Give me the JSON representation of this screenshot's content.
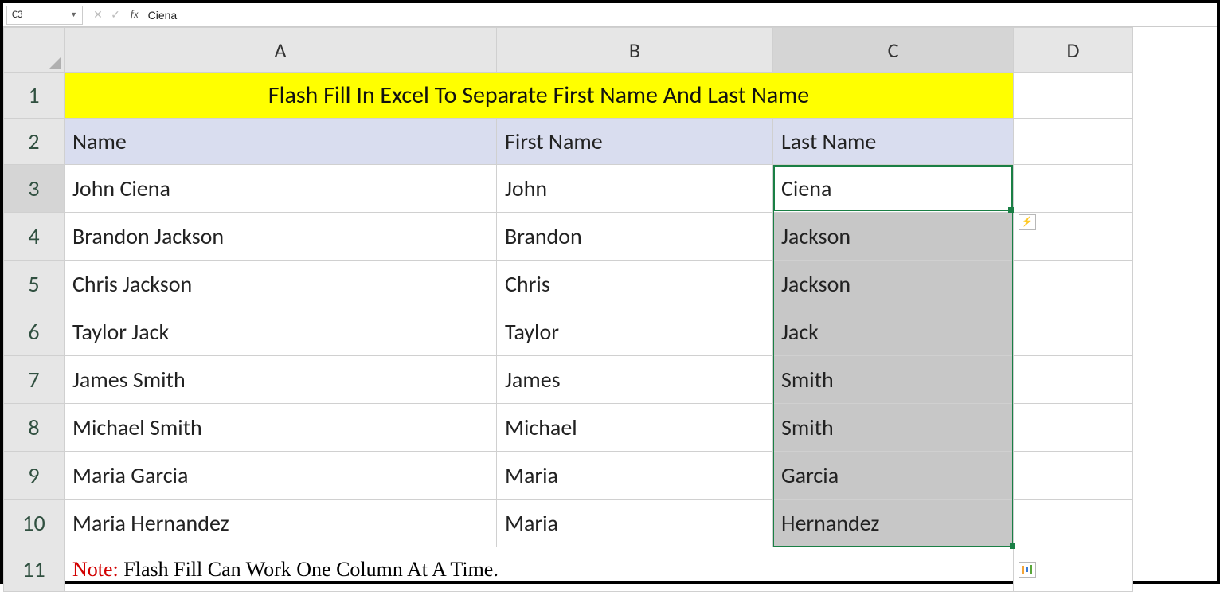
{
  "formula_bar": {
    "cell_ref": "C3",
    "fx_label": "fx",
    "formula_value": "Ciena"
  },
  "columns": {
    "a": "A",
    "b": "B",
    "c": "C",
    "d": "D"
  },
  "rows": [
    "1",
    "2",
    "3",
    "4",
    "5",
    "6",
    "7",
    "8",
    "9",
    "10",
    "11"
  ],
  "title": "Flash Fill In Excel To Separate First Name And Last Name",
  "headers": {
    "name": "Name",
    "first": "First Name",
    "last": "Last Name"
  },
  "data_rows": [
    {
      "name": "John Ciena",
      "first": "John",
      "last": "Ciena",
      "suggested": false
    },
    {
      "name": "Brandon Jackson",
      "first": "Brandon",
      "last": "Jackson",
      "suggested": true
    },
    {
      "name": "Chris Jackson",
      "first": "Chris",
      "last": "Jackson",
      "suggested": true
    },
    {
      "name": "Taylor Jack",
      "first": "Taylor",
      "last": "Jack",
      "suggested": true
    },
    {
      "name": "James Smith",
      "first": "James",
      "last": "Smith",
      "suggested": true
    },
    {
      "name": "Michael Smith",
      "first": "Michael",
      "last": "Smith",
      "suggested": true
    },
    {
      "name": "Maria Garcia",
      "first": "Maria",
      "last": "Garcia",
      "suggested": true
    },
    {
      "name": "Maria Hernandez",
      "first": "Maria",
      "last": "Hernandez",
      "suggested": true
    }
  ],
  "note": {
    "label": "Note:",
    "text": " Flash Fill Can Work One Column At A Time."
  },
  "selection": {
    "active_cell": "C3",
    "range": "C3:C10"
  }
}
